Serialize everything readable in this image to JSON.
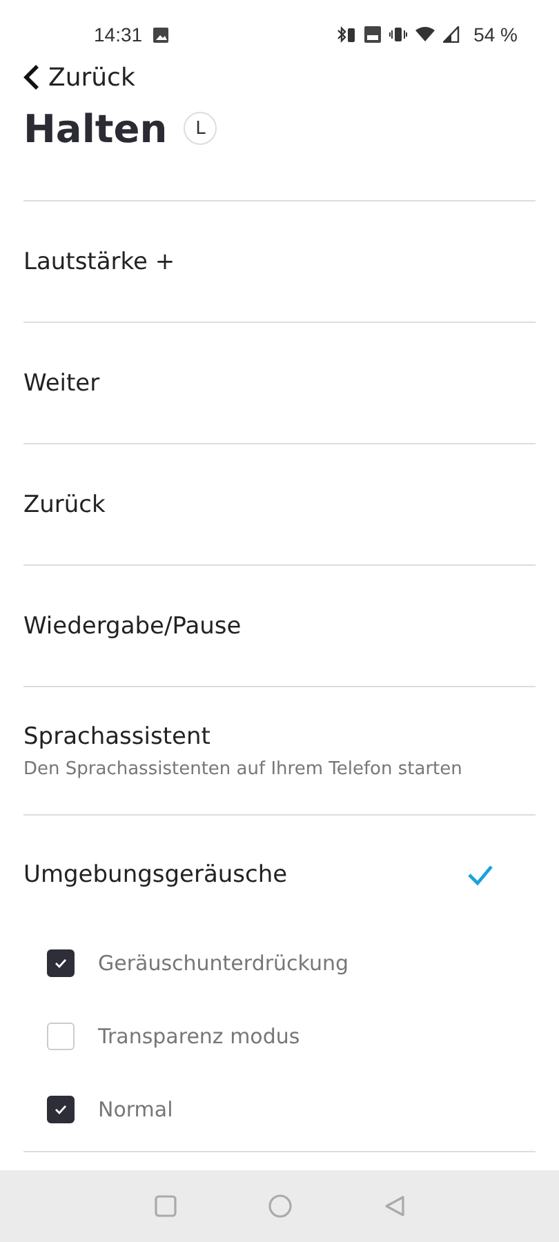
{
  "status_bar": {
    "time": "14:31",
    "battery": "54 %"
  },
  "back": {
    "label": "Zurück"
  },
  "title": "Halten",
  "side_badge": "L",
  "actions": [
    {
      "label": "Lautstärke +",
      "selected": false
    },
    {
      "label": "Weiter",
      "selected": false
    },
    {
      "label": "Zurück",
      "selected": false
    },
    {
      "label": "Wiedergabe/Pause",
      "selected": false
    },
    {
      "label": "Sprachassistent",
      "description": "Den Sprachassistenten auf Ihrem Telefon starten",
      "selected": false
    },
    {
      "label": "Umgebungsgeräusche",
      "selected": true,
      "options": [
        {
          "label": "Geräuschunterdrückung",
          "checked": true
        },
        {
          "label": "Transparenz modus",
          "checked": false
        },
        {
          "label": "Normal",
          "checked": true
        }
      ]
    }
  ]
}
